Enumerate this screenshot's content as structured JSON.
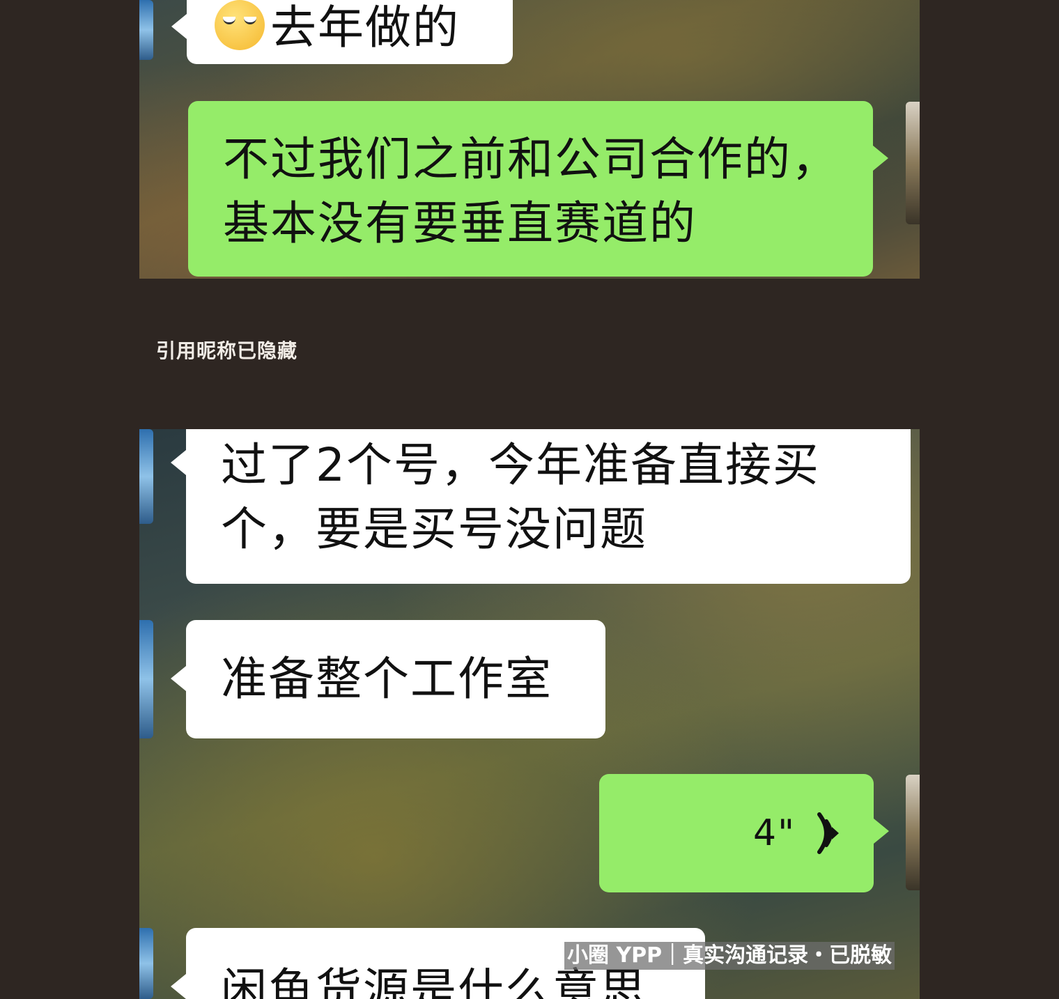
{
  "top_panel": {
    "messages": [
      {
        "side": "left",
        "emoji": "rolling-eyes",
        "text": "去年做的"
      },
      {
        "side": "right",
        "lines": [
          "不过我们之前和公司合作的，",
          "基本没有要垂直赛道的"
        ]
      }
    ]
  },
  "quote_label": "引用昵称已隐藏",
  "bottom_panel": {
    "messages": [
      {
        "side": "left",
        "lines": [
          "过了2个号，今年准备直接买",
          "个，要是买号没问题"
        ]
      },
      {
        "side": "left",
        "text": "准备整个工作室"
      },
      {
        "side": "right",
        "type": "voice",
        "duration": "4\""
      },
      {
        "side": "left",
        "text": "闲鱼货源是什么意思"
      }
    ]
  },
  "watermark": "小圈 YPP｜真实沟通记录・已脱敏",
  "colors": {
    "green_bubble": "#95ec69",
    "white_bubble": "#ffffff",
    "page_bg": "#2e2622"
  }
}
